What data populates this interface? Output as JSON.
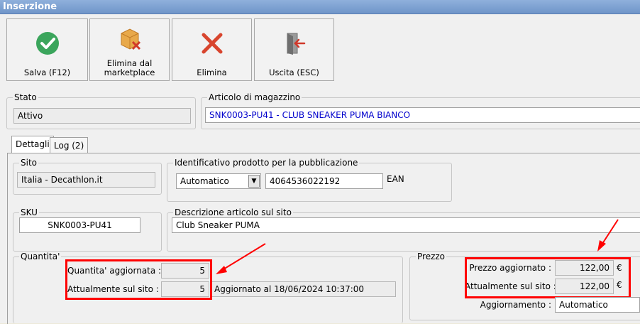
{
  "window": {
    "title": "Inserzione"
  },
  "toolbar": {
    "save_label": "Salva (F12)",
    "remove_label": "Elimina dal marketplace",
    "delete_label": "Elimina",
    "exit_label": "Uscita (ESC)"
  },
  "stato": {
    "legend": "Stato",
    "value": "Attivo"
  },
  "articolo": {
    "legend": "Articolo di magazzino",
    "value": "SNK0003-PU41 - CLUB SNEAKER PUMA BIANCO"
  },
  "tabs": [
    {
      "label": "Dettagli"
    },
    {
      "label": "Log (2)"
    }
  ],
  "sito": {
    "legend": "Sito",
    "value": "Italia - Decathlon.it"
  },
  "identificativo": {
    "legend": "Identificativo prodotto per la pubblicazione",
    "mode": "Automatico",
    "code": "4064536022192",
    "type_label": "EAN"
  },
  "sku": {
    "legend": "SKU",
    "value": "SNK0003-PU41"
  },
  "descrizione": {
    "legend": "Descrizione articolo sul sito",
    "value": "Club Sneaker PUMA"
  },
  "quantita": {
    "legend": "Quantita'",
    "updated_label": "Quantita' aggiornata :",
    "updated_value": "5",
    "current_label": "Attualmente sul sito :",
    "current_value": "5",
    "status": "Aggiornato al 18/06/2024 10:37:00"
  },
  "prezzo": {
    "legend": "Prezzo",
    "updated_label": "Prezzo aggiornato :",
    "updated_value": "122,00",
    "current_label": "Attualmente sul sito :",
    "current_value": "122,00",
    "currency": "€",
    "update_label": "Aggiornamento :",
    "update_mode": "Automatico"
  },
  "colors": {
    "highlight": "#ff0000",
    "link_text": "#0000cc"
  }
}
